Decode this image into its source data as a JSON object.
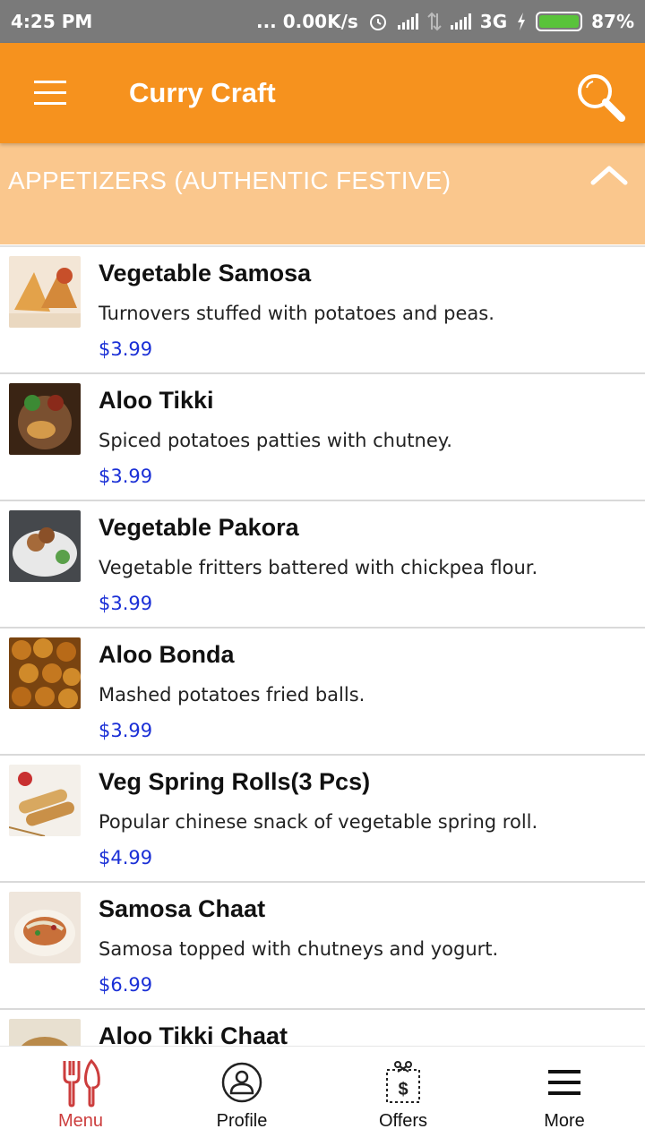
{
  "status_bar": {
    "time": "4:25 PM",
    "net_speed": "... 0.00K/s",
    "network": "3G",
    "battery": "87%"
  },
  "header": {
    "title": "Curry Craft",
    "menu_icon": "hamburger-icon",
    "search_icon": "search-icon",
    "color": "#f6921e"
  },
  "category": {
    "label": "APPETIZERS (AUTHENTIC FESTIVE)",
    "icon": "chevron-up-icon",
    "color": "#fac78d"
  },
  "items": [
    {
      "name": "Vegetable Samosa",
      "description": "Turnovers stuffed with potatoes and peas.",
      "price": "$3.99",
      "thumb_color": "#e3a24a"
    },
    {
      "name": "Aloo Tikki",
      "description": "Spiced potatoes patties with chutney.",
      "price": "$3.99",
      "thumb_color": "#6b3e1e"
    },
    {
      "name": "Vegetable Pakora",
      "description": "Vegetable fritters battered with chickpea flour.",
      "price": "$3.99",
      "thumb_color": "#a56a3a"
    },
    {
      "name": "Aloo Bonda",
      "description": "Mashed potatoes fried balls.",
      "price": "$3.99",
      "thumb_color": "#c47820"
    },
    {
      "name": "Veg Spring Rolls(3 Pcs)",
      "description": "Popular chinese snack of vegetable spring roll.",
      "price": "$4.99",
      "thumb_color": "#d8b070"
    },
    {
      "name": "Samosa Chaat",
      "description": "Samosa topped with chutneys and yogurt.",
      "price": "$6.99",
      "thumb_color": "#c8703a"
    },
    {
      "name": "Aloo Tikki Chaat",
      "description": "",
      "price": "",
      "thumb_color": "#b98a4a"
    }
  ],
  "bottom_nav": [
    {
      "label": "Menu",
      "icon": "fork-knife-icon",
      "active": true
    },
    {
      "label": "Profile",
      "icon": "profile-icon",
      "active": false
    },
    {
      "label": "Offers",
      "icon": "offers-icon",
      "active": false
    },
    {
      "label": "More",
      "icon": "more-menu-icon",
      "active": false
    }
  ],
  "colors": {
    "accent": "#f6921e",
    "price": "#1a2fd6",
    "active_nav": "#cc3d3d"
  }
}
